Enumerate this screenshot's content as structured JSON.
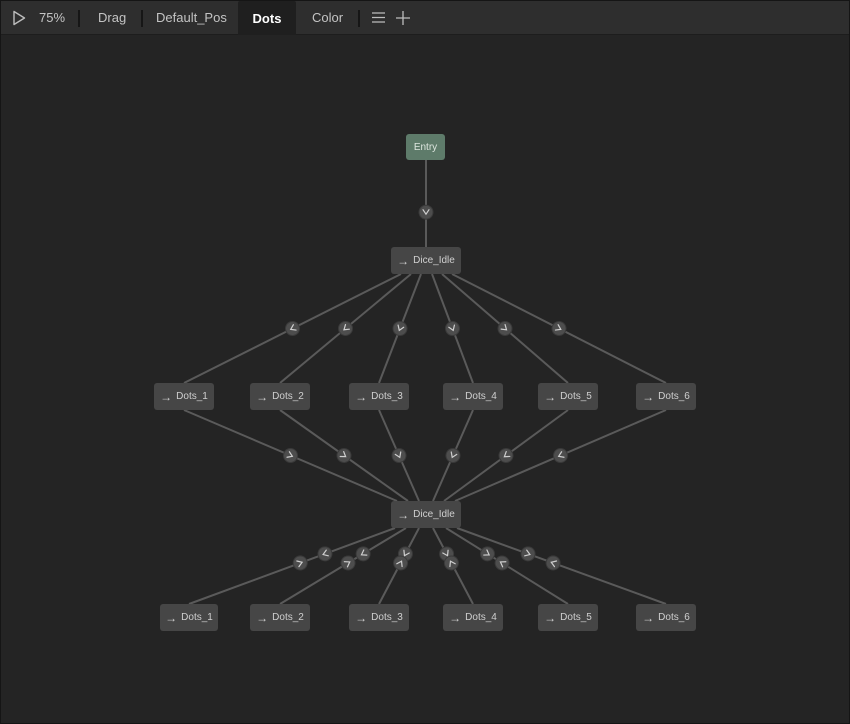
{
  "toolbar": {
    "zoom": "75%",
    "tabs": [
      {
        "label": "Drag",
        "active": false
      },
      {
        "label": "Default_Pos",
        "active": false
      },
      {
        "label": "Dots",
        "active": true
      },
      {
        "label": "Color",
        "active": false
      }
    ],
    "icons": {
      "play": "play-icon",
      "menu": "menu-icon",
      "add": "plus-icon"
    }
  },
  "graph": {
    "arrow_glyph": "→",
    "entry": {
      "label": "Entry"
    },
    "idle_top": {
      "label": "Dice_Idle"
    },
    "row1": [
      {
        "label": "Dots_1"
      },
      {
        "label": "Dots_2"
      },
      {
        "label": "Dots_3"
      },
      {
        "label": "Dots_4"
      },
      {
        "label": "Dots_5"
      },
      {
        "label": "Dots_6"
      }
    ],
    "idle_bottom": {
      "label": "Dice_Idle"
    },
    "row2": [
      {
        "label": "Dots_1"
      },
      {
        "label": "Dots_2"
      },
      {
        "label": "Dots_3"
      },
      {
        "label": "Dots_4"
      },
      {
        "label": "Dots_5"
      },
      {
        "label": "Dots_6"
      }
    ]
  },
  "colors": {
    "background": "#242424",
    "tabbar": "#2e2e2e",
    "node": "#464646",
    "entry_node": "#5e7b6a",
    "edge": "#5a5a5a",
    "transition_marker": "#4d4d4d"
  }
}
